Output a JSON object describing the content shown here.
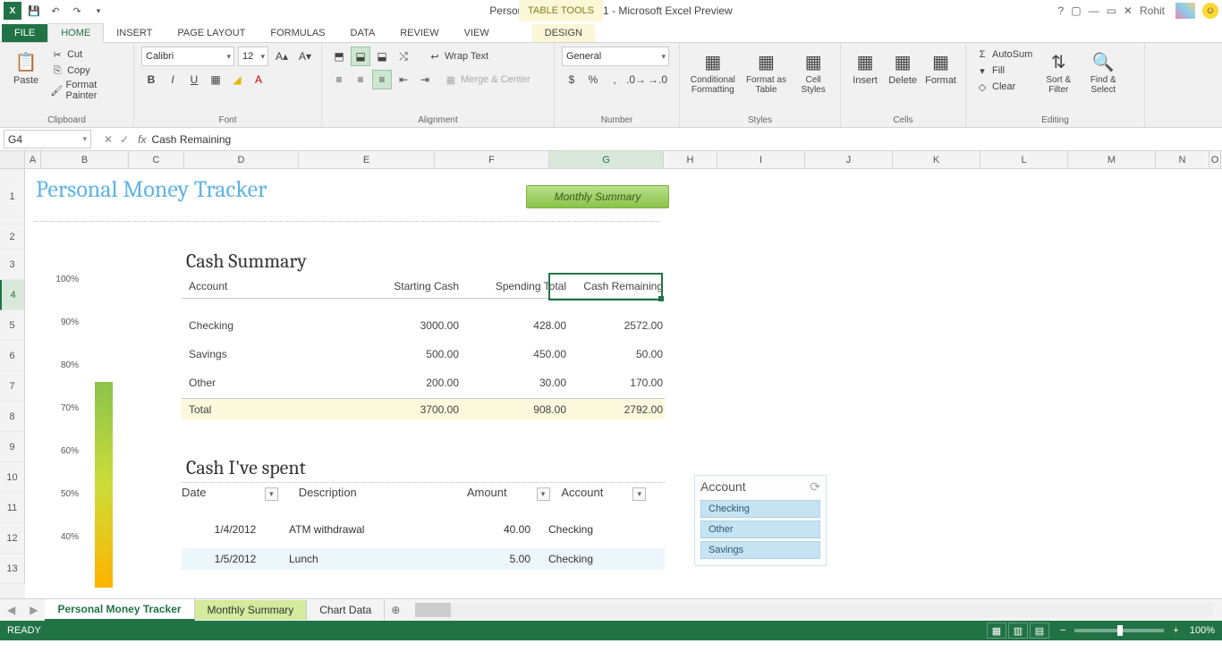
{
  "app": {
    "title": "Personal money tracker1 - Microsoft Excel Preview",
    "table_tools": "TABLE TOOLS",
    "username": "Rohit"
  },
  "tabs": {
    "file": "FILE",
    "home": "HOME",
    "insert": "INSERT",
    "pagelayout": "PAGE LAYOUT",
    "formulas": "FORMULAS",
    "data": "DATA",
    "review": "REVIEW",
    "view": "VIEW",
    "design": "DESIGN"
  },
  "ribbon": {
    "clipboard": {
      "paste": "Paste",
      "cut": "Cut",
      "copy": "Copy",
      "format_painter": "Format Painter",
      "label": "Clipboard"
    },
    "font": {
      "name": "Calibri",
      "size": "12",
      "label": "Font"
    },
    "alignment": {
      "wrap": "Wrap Text",
      "merge": "Merge & Center",
      "label": "Alignment"
    },
    "number": {
      "format": "General",
      "label": "Number"
    },
    "styles": {
      "cond": "Conditional Formatting",
      "table": "Format as Table",
      "cell": "Cell Styles",
      "label": "Styles"
    },
    "cells": {
      "insert": "Insert",
      "delete": "Delete",
      "format": "Format",
      "label": "Cells"
    },
    "editing": {
      "autosum": "AutoSum",
      "fill": "Fill",
      "clear": "Clear",
      "sort": "Sort & Filter",
      "find": "Find & Select",
      "label": "Editing"
    }
  },
  "formula_bar": {
    "cell_ref": "G4",
    "formula": "Cash Remaining"
  },
  "columns": [
    "A",
    "B",
    "C",
    "D",
    "E",
    "F",
    "G",
    "H",
    "I",
    "J",
    "K",
    "L",
    "M",
    "N",
    "O"
  ],
  "rows": [
    "1",
    "2",
    "3",
    "4",
    "5",
    "6",
    "7",
    "8",
    "9",
    "10",
    "11",
    "12",
    "13"
  ],
  "sheet": {
    "title": "Personal Money Tracker",
    "monthly_btn": "Monthly Summary",
    "summary_title": "Cash Summary",
    "summary_headers": {
      "account": "Account",
      "starting": "Starting Cash",
      "spending": "Spending Total",
      "remaining": "Cash Remaining"
    },
    "summary_rows": [
      {
        "account": "Checking",
        "starting": "3000.00",
        "spending": "428.00",
        "remaining": "2572.00"
      },
      {
        "account": "Savings",
        "starting": "500.00",
        "spending": "450.00",
        "remaining": "50.00"
      },
      {
        "account": "Other",
        "starting": "200.00",
        "spending": "30.00",
        "remaining": "170.00"
      }
    ],
    "summary_total": {
      "account": "Total",
      "starting": "3700.00",
      "spending": "908.00",
      "remaining": "2792.00"
    },
    "spent_title": "Cash I've spent",
    "spent_headers": {
      "date": "Date",
      "desc": "Description",
      "amount": "Amount",
      "account": "Account"
    },
    "spent_rows": [
      {
        "date": "1/4/2012",
        "desc": "ATM withdrawal",
        "amount": "40.00",
        "account": "Checking"
      },
      {
        "date": "1/5/2012",
        "desc": "Lunch",
        "amount": "5.00",
        "account": "Checking"
      }
    ],
    "slicer": {
      "title": "Account",
      "items": [
        "Checking",
        "Other",
        "Savings"
      ]
    },
    "chart_ticks": [
      "100%",
      "90%",
      "80%",
      "70%",
      "60%",
      "50%",
      "40%"
    ]
  },
  "sheet_tabs": {
    "t1": "Personal Money Tracker",
    "t2": "Monthly Summary",
    "t3": "Chart Data"
  },
  "status": {
    "ready": "READY",
    "zoom": "100%"
  }
}
